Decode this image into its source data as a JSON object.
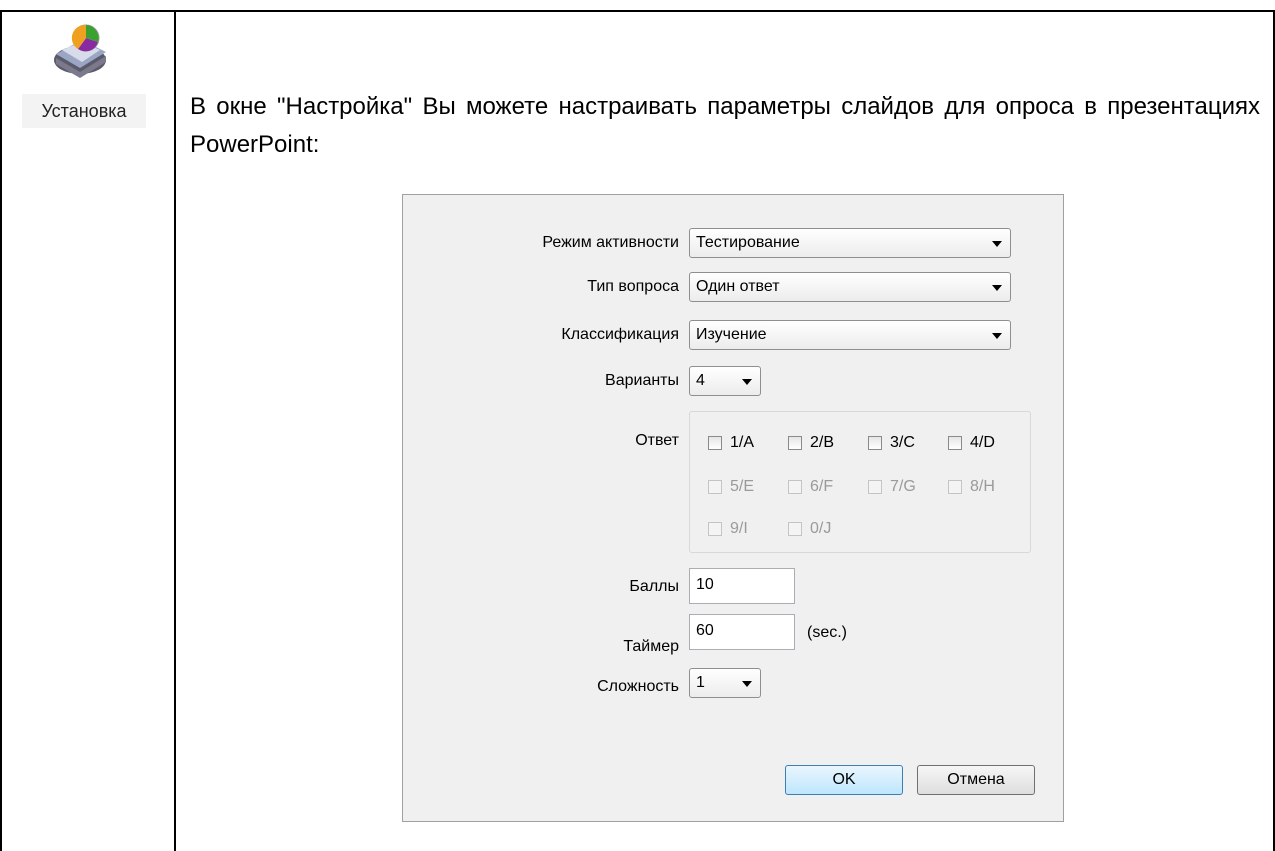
{
  "sidebar": {
    "label": "Установка"
  },
  "intro_text": "В окне \"Настройка\" Вы можете настраивать параметры слайдов для опроса в презентациях PowerPoint:",
  "dialog": {
    "fields": {
      "activity_mode": {
        "label": "Режим активности",
        "value": "Тестирование"
      },
      "question_type": {
        "label": "Тип вопроса",
        "value": "Один ответ"
      },
      "classification": {
        "label": "Классификация",
        "value": "Изучение"
      },
      "options": {
        "label": "Варианты",
        "value": "4"
      },
      "answer": {
        "label": "Ответ",
        "choices": [
          {
            "label": "1/A",
            "enabled": true,
            "checked": false
          },
          {
            "label": "2/B",
            "enabled": true,
            "checked": false
          },
          {
            "label": "3/C",
            "enabled": true,
            "checked": false
          },
          {
            "label": "4/D",
            "enabled": true,
            "checked": false
          },
          {
            "label": "5/E",
            "enabled": false,
            "checked": false
          },
          {
            "label": "6/F",
            "enabled": false,
            "checked": false
          },
          {
            "label": "7/G",
            "enabled": false,
            "checked": false
          },
          {
            "label": "8/H",
            "enabled": false,
            "checked": false
          },
          {
            "label": "9/I",
            "enabled": false,
            "checked": false
          },
          {
            "label": "0/J",
            "enabled": false,
            "checked": false
          }
        ]
      },
      "points": {
        "label": "Баллы",
        "value": "10"
      },
      "timer": {
        "label": "Таймер",
        "value": "60",
        "unit": "(sec.)"
      },
      "difficulty": {
        "label": "Сложность",
        "value": "1"
      }
    },
    "buttons": {
      "ok": "OK",
      "cancel": "Отмена"
    }
  }
}
